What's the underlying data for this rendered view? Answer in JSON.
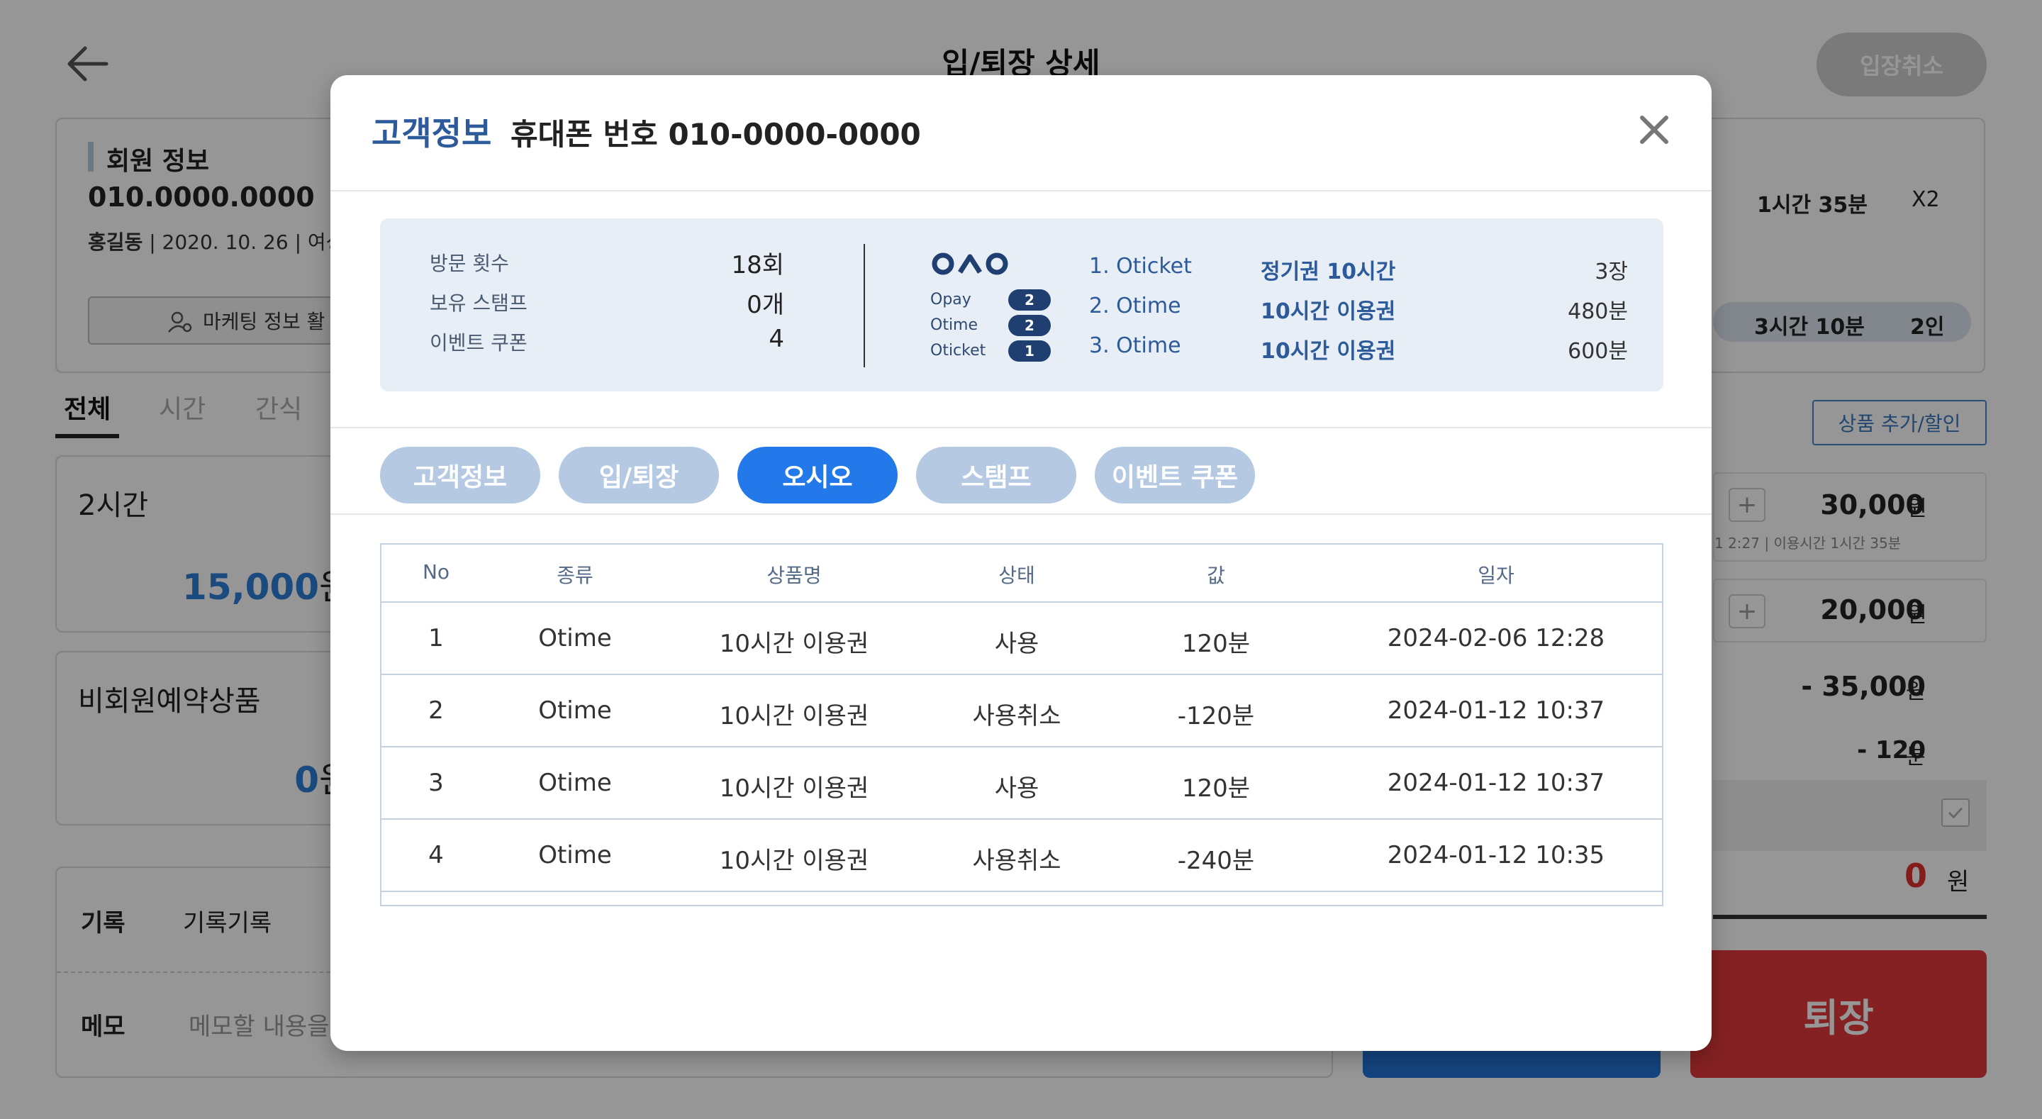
{
  "page": {
    "title": "입/퇴장 상세",
    "cancel_entry_label": "입장취소",
    "member": {
      "section_title": "회원 정보",
      "phone": "010.0000.0000",
      "name": "홍길동",
      "birth": "2020. 10. 26",
      "gender": "여성",
      "marketing_button": "마케팅 정보 활"
    },
    "summary": {
      "time1": "1시간 35분",
      "count": "X2",
      "time2": "3시간 10분",
      "people": "2인"
    },
    "tabs": [
      "전체",
      "시간",
      "간식"
    ],
    "add_product_label": "상품 추가/할인",
    "products": [
      {
        "name": "2시간",
        "price": "15,000",
        "unit": "원"
      },
      {
        "name": "비회원예약상품",
        "price": "0",
        "unit": "원"
      }
    ],
    "right_rows": [
      {
        "amount": "30,000",
        "unit": "원",
        "sub": "1 2:27 | 이용시간 1시간 35분"
      },
      {
        "amount": "20,000",
        "unit": "원"
      },
      {
        "amount": "- 35,000",
        "unit": "원"
      },
      {
        "amount": "- 120",
        "unit": "분"
      }
    ],
    "record": {
      "label": "기록",
      "value": "기록기록"
    },
    "memo": {
      "label": "메모",
      "placeholder": "메모할 내용을"
    },
    "total": {
      "amount": "0",
      "unit": "원"
    },
    "exit_label": "퇴장"
  },
  "modal": {
    "title": "고객정보",
    "phone_label": "휴대폰 번호 010-0000-0000",
    "stats": [
      {
        "label": "방문 횟수",
        "value": "18회"
      },
      {
        "label": "보유 스탬프",
        "value": "0개"
      },
      {
        "label": "이벤트 쿠폰",
        "value": "4"
      }
    ],
    "points": [
      {
        "label": "Opay",
        "count": "2"
      },
      {
        "label": "Otime",
        "count": "2"
      },
      {
        "label": "Oticket",
        "count": "1"
      }
    ],
    "tickets": [
      {
        "name": "1. Oticket",
        "kind": "정기권 10시간",
        "qty": "3장"
      },
      {
        "name": "2. Otime",
        "kind": "10시간 이용권",
        "qty": "480분"
      },
      {
        "name": "3. Otime",
        "kind": "10시간 이용권",
        "qty": "600분"
      }
    ],
    "tabs": [
      {
        "label": "고객정보",
        "active": false
      },
      {
        "label": "입/퇴장",
        "active": false
      },
      {
        "label": "오시오",
        "active": true
      },
      {
        "label": "스탬프",
        "active": false
      },
      {
        "label": "이벤트 쿠폰",
        "active": false
      }
    ],
    "table": {
      "headers": [
        "No",
        "종류",
        "상품명",
        "상태",
        "값",
        "일자"
      ],
      "rows": [
        [
          "1",
          "Otime",
          "10시간 이용권",
          "사용",
          "120분",
          "2024-02-06 12:28"
        ],
        [
          "2",
          "Otime",
          "10시간 이용권",
          "사용취소",
          "-120분",
          "2024-01-12 10:37"
        ],
        [
          "3",
          "Otime",
          "10시간 이용권",
          "사용",
          "120분",
          "2024-01-12 10:37"
        ],
        [
          "4",
          "Otime",
          "10시간 이용권",
          "사용취소",
          "-240분",
          "2024-01-12 10:35"
        ]
      ]
    }
  },
  "colors": {
    "accent_blue": "#2379ea",
    "title_blue": "#2d5a9a",
    "inactive_tab": "#b6c9e2",
    "exit_red": "#e2393a"
  }
}
